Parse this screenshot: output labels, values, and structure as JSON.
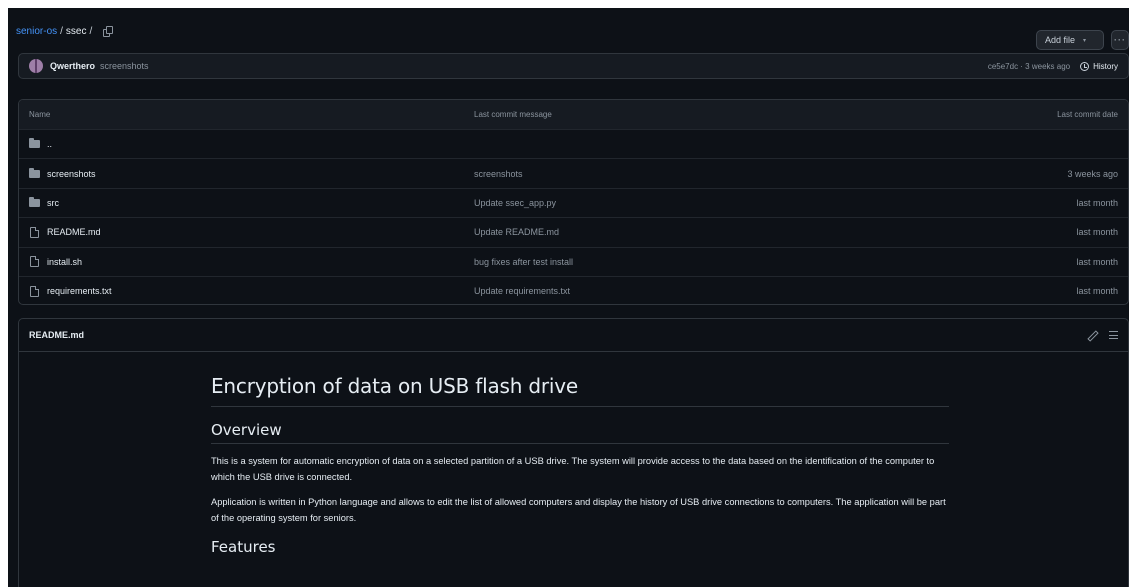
{
  "breadcrumb": {
    "repo": "senior-os",
    "separator": "/",
    "folder": "ssec",
    "trailing": "/"
  },
  "toolbar": {
    "add_file_label": "Add file",
    "add_file_caret": "▾",
    "more_label": "···"
  },
  "commit": {
    "author": "Qwerthero",
    "message": "screenshots",
    "meta": "ce5e7dc · 3 weeks ago",
    "history_label": "History"
  },
  "files": {
    "headers": {
      "name": "Name",
      "message": "Last commit message",
      "date": "Last commit date"
    },
    "rows": [
      {
        "icon": "folder-icon",
        "name": "..",
        "message": "",
        "date": ""
      },
      {
        "icon": "folder-icon",
        "name": "screenshots",
        "message": "screenshots",
        "date": "3 weeks ago"
      },
      {
        "icon": "folder-icon",
        "name": "src",
        "message": "Update ssec_app.py",
        "date": "last month"
      },
      {
        "icon": "file-icon",
        "name": "README.md",
        "message": "Update README.md",
        "date": "last month"
      },
      {
        "icon": "file-icon",
        "name": "install.sh",
        "message": "bug fixes after test install",
        "date": "last month"
      },
      {
        "icon": "file-icon",
        "name": "requirements.txt",
        "message": "Update requirements.txt",
        "date": "last month"
      }
    ]
  },
  "readme": {
    "title": "README.md",
    "h1": "Encryption of data on USB flash drive",
    "overview_heading": "Overview",
    "p1": "This is a system for automatic encryption of data on a selected partition of a USB drive. The system will provide access to the data based on the identification of the computer to which the USB drive is connected.",
    "p2": "Application is written in Python language and allows to edit the list of allowed computers and display the history of USB drive connections to computers. The application will be part of the operating system for seniors.",
    "features_heading": "Features"
  },
  "colors": {
    "background": "#0d1117",
    "link": "#4493f8",
    "muted": "#8b949e",
    "border": "#30363d"
  }
}
